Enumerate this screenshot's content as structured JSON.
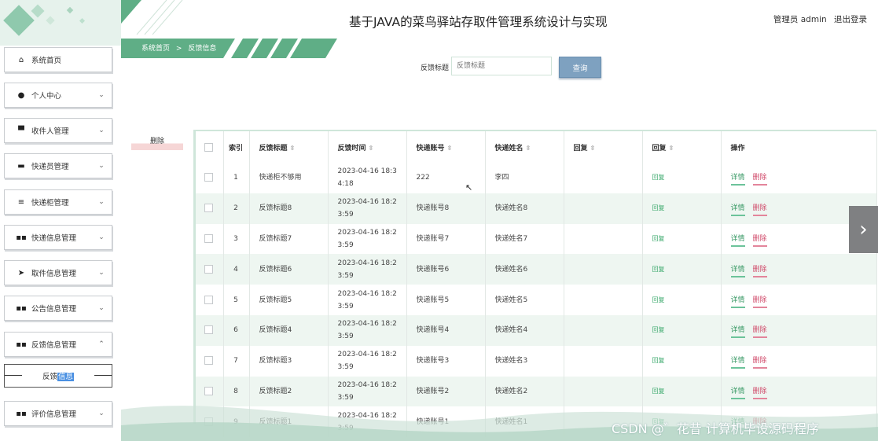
{
  "header": {
    "title": "基于JAVA的菜鸟驿站存取件管理系统设计与实现",
    "user": "管理员 admin",
    "logout": "退出登录"
  },
  "breadcrumb": {
    "home": "系统首页",
    "sep": ">",
    "current": "反馈信息"
  },
  "sidebar": {
    "items": [
      {
        "label": "系统首页",
        "icon": "home-icon",
        "glyph": "⌂",
        "chevron": ""
      },
      {
        "label": "个人中心",
        "icon": "user-icon",
        "glyph": "●",
        "chevron": "⌄"
      },
      {
        "label": "收件人管理",
        "icon": "monitor-icon",
        "glyph": "▀",
        "chevron": "⌄"
      },
      {
        "label": "快递员管理",
        "icon": "chat-icon",
        "glyph": "▬",
        "chevron": "⌄"
      },
      {
        "label": "快递柜管理",
        "icon": "list-icon",
        "glyph": "≡",
        "chevron": "⌄"
      },
      {
        "label": "快递信息管理",
        "icon": "grid-icon",
        "glyph": "▪▪",
        "chevron": "⌄"
      },
      {
        "label": "取件信息管理",
        "icon": "send-icon",
        "glyph": "➤",
        "chevron": "⌄"
      },
      {
        "label": "公告信息管理",
        "icon": "grid-icon",
        "glyph": "▪▪",
        "chevron": "⌄"
      },
      {
        "label": "反馈信息管理",
        "icon": "grid-icon",
        "glyph": "▪▪",
        "chevron": "⌃"
      },
      {
        "label": "评价信息管理",
        "icon": "grid-icon",
        "glyph": "▪▪",
        "chevron": "⌄"
      }
    ],
    "sub_item_pre": "反馈",
    "sub_item_hl": "信息"
  },
  "search": {
    "label": "反馈标题",
    "placeholder": "反馈标题",
    "button": "查询"
  },
  "actions": {
    "delete": "删除"
  },
  "table": {
    "headers": [
      "索引",
      "反馈标题",
      "反馈时间",
      "快递账号",
      "快递姓名",
      "回复",
      "回复",
      "操作"
    ],
    "rows": [
      {
        "idx": "1",
        "title": "快递柜不够用",
        "time": "2023-04-16 18:34:18",
        "account": "222",
        "name": "李四",
        "reply": "",
        "reply_link": "回复"
      },
      {
        "idx": "2",
        "title": "反馈标题8",
        "time": "2023-04-16 18:23:59",
        "account": "快递账号8",
        "name": "快递姓名8",
        "reply": "",
        "reply_link": "回复"
      },
      {
        "idx": "3",
        "title": "反馈标题7",
        "time": "2023-04-16 18:23:59",
        "account": "快递账号7",
        "name": "快递姓名7",
        "reply": "",
        "reply_link": "回复"
      },
      {
        "idx": "4",
        "title": "反馈标题6",
        "time": "2023-04-16 18:23:59",
        "account": "快递账号6",
        "name": "快递姓名6",
        "reply": "",
        "reply_link": "回复"
      },
      {
        "idx": "5",
        "title": "反馈标题5",
        "time": "2023-04-16 18:23:59",
        "account": "快递账号5",
        "name": "快递姓名5",
        "reply": "",
        "reply_link": "回复"
      },
      {
        "idx": "6",
        "title": "反馈标题4",
        "time": "2023-04-16 18:23:59",
        "account": "快递账号4",
        "name": "快递姓名4",
        "reply": "",
        "reply_link": "回复"
      },
      {
        "idx": "7",
        "title": "反馈标题3",
        "time": "2023-04-16 18:23:59",
        "account": "快递账号3",
        "name": "快递姓名3",
        "reply": "",
        "reply_link": "回复"
      },
      {
        "idx": "8",
        "title": "反馈标题2",
        "time": "2023-04-16 18:23:59",
        "account": "快递账号2",
        "name": "快递姓名2",
        "reply": "",
        "reply_link": "回复"
      },
      {
        "idx": "9",
        "title": "反馈标题1",
        "time": "2023-04-16 18:23:59",
        "account": "快递账号1",
        "name": "快递姓名1",
        "reply": "",
        "reply_link": "回复"
      }
    ],
    "op_detail": "详情",
    "op_delete": "删除"
  },
  "watermark": "CSDN @゛花昔 计算机毕设源码程序",
  "colors": {
    "accent_green": "#3a9a66",
    "table_stripe": "#eef6f1",
    "search_button": "#7ea1c0",
    "delete_link": "#d04a6a"
  }
}
